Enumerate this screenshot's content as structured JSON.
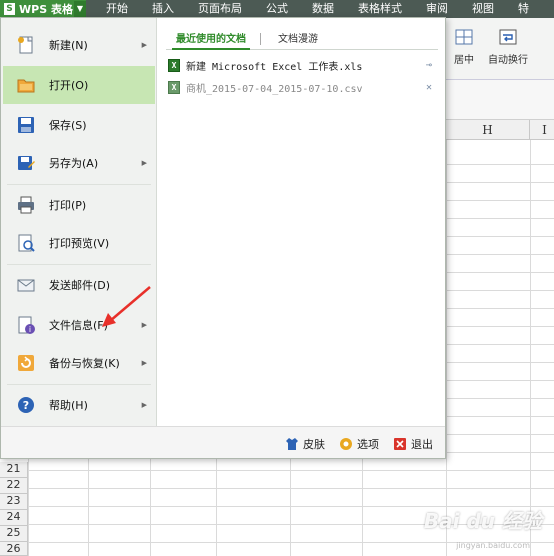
{
  "app": {
    "name": "WPS 表格",
    "logo_letter": "S"
  },
  "tabs": [
    "开始",
    "插入",
    "页面布局",
    "公式",
    "数据",
    "表格样式",
    "审阅",
    "视图",
    "特"
  ],
  "ribbon": {
    "merge_center": "居中",
    "wrap": "自动换行"
  },
  "grid": {
    "columns": [
      "H",
      "I"
    ],
    "rows": [
      "21",
      "22",
      "23",
      "24",
      "25",
      "26"
    ]
  },
  "menu": {
    "items": [
      {
        "label": "新建",
        "key": "(N)",
        "icon": "new-doc-icon",
        "has_sub": true
      },
      {
        "label": "打开",
        "key": "(O)",
        "icon": "open-folder-icon",
        "has_sub": false,
        "active": true
      },
      {
        "label": "保存",
        "key": "(S)",
        "icon": "save-icon",
        "has_sub": false
      },
      {
        "label": "另存为",
        "key": "(A)",
        "icon": "save-as-icon",
        "has_sub": true
      },
      {
        "label": "打印",
        "key": "(P)",
        "icon": "print-icon",
        "has_sub": false
      },
      {
        "label": "打印预览",
        "key": "(V)",
        "icon": "print-preview-icon",
        "has_sub": false
      },
      {
        "label": "发送邮件",
        "key": "(D)",
        "icon": "mail-icon",
        "has_sub": false
      },
      {
        "label": "文件信息",
        "key": "(F)",
        "icon": "file-info-icon",
        "has_sub": true
      },
      {
        "label": "备份与恢复",
        "key": "(K)",
        "icon": "backup-icon",
        "has_sub": true
      },
      {
        "label": "帮助",
        "key": "(H)",
        "icon": "help-icon",
        "has_sub": true
      }
    ],
    "recent_tabs": {
      "recent": "最近使用的文档",
      "roam": "文档漫游"
    },
    "recent_files": [
      {
        "name": "新建 Microsoft Excel 工作表.xls",
        "pinned": true
      },
      {
        "name": "商机_2015-07-04_2015-07-10.csv",
        "pinned": false
      }
    ],
    "bottom": {
      "skin": "皮肤",
      "options": "选项",
      "exit": "退出"
    }
  },
  "watermark": {
    "text": "Bai du 经验",
    "sub": "jingyan.baidu.com"
  },
  "colors": {
    "accent": "#2f8b2a",
    "active_bg": "#c7e6b3",
    "arrow": "#e8302a"
  }
}
